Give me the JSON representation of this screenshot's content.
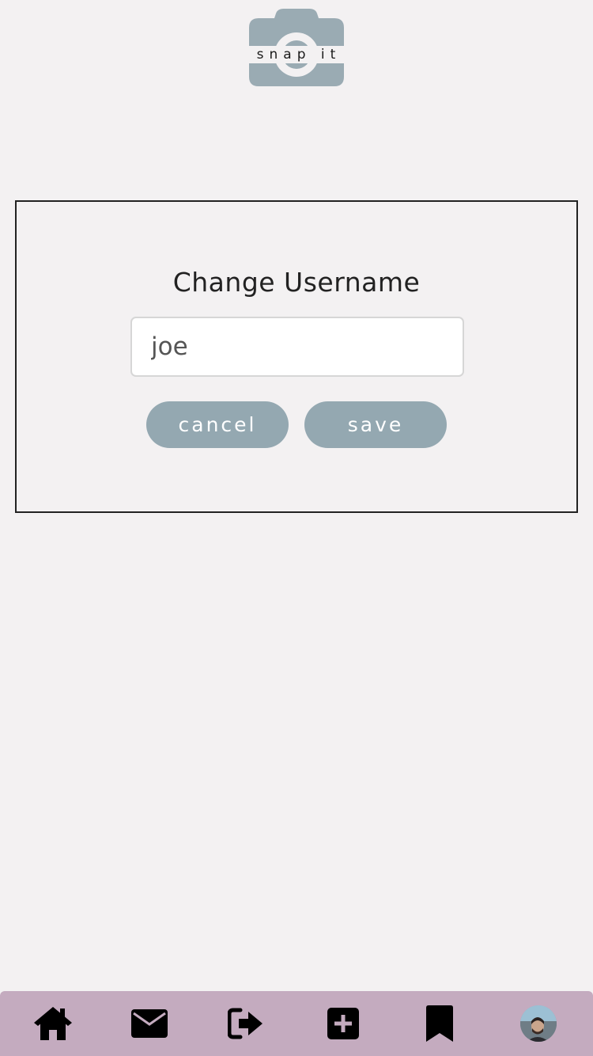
{
  "app": {
    "logo_text": "snap it",
    "logo_color": "#9aabb3"
  },
  "dialog": {
    "title": "Change Username",
    "username_value": "joe",
    "cancel_label": "cancel",
    "save_label": "save",
    "button_color": "#94a8b1"
  },
  "bottom_nav": {
    "background": "#c4abbf",
    "items": [
      {
        "icon": "home-icon"
      },
      {
        "icon": "envelope-icon"
      },
      {
        "icon": "sign-out-icon"
      },
      {
        "icon": "plus-square-icon"
      },
      {
        "icon": "bookmark-icon"
      },
      {
        "icon": "avatar"
      }
    ]
  }
}
